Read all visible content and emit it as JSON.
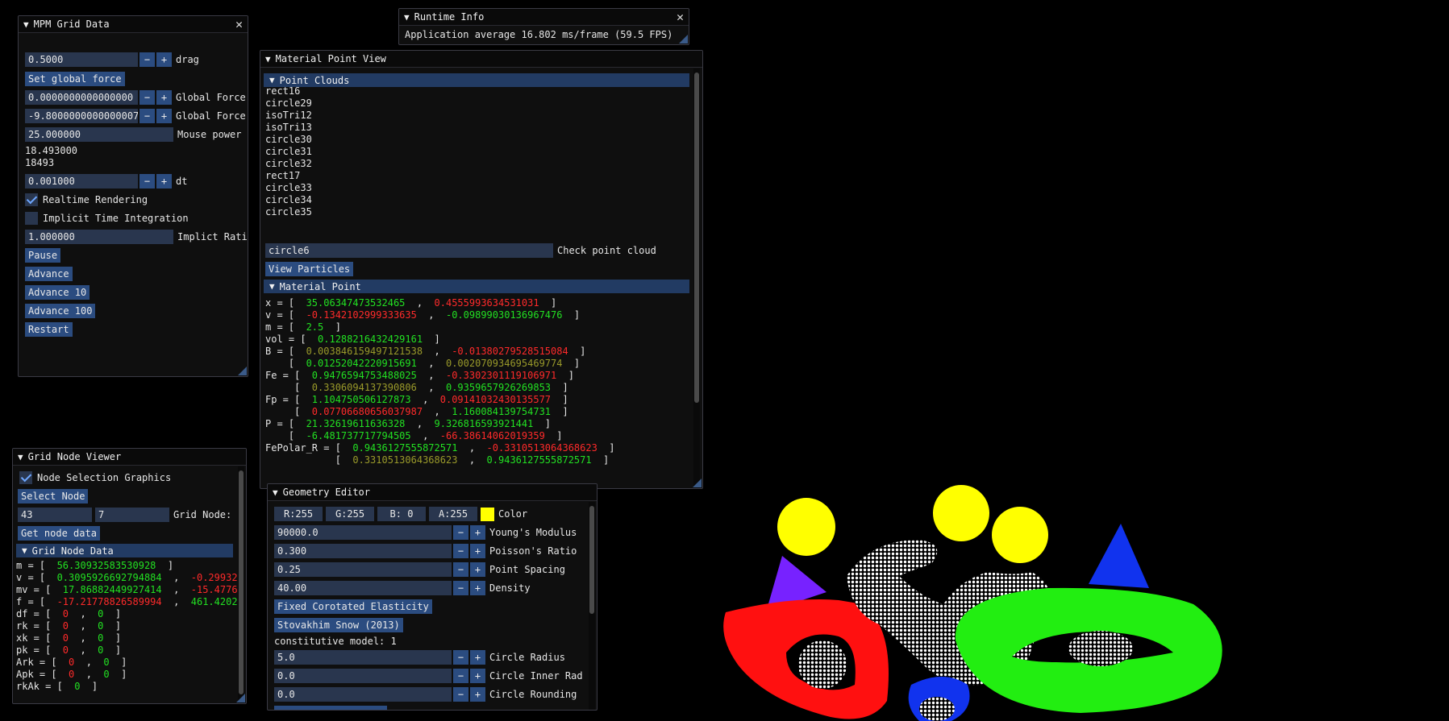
{
  "mpm": {
    "title": "MPM Grid Data",
    "drag": {
      "value": "0.5000",
      "label": "drag"
    },
    "set_force_btn": "Set global force",
    "force_x": {
      "value": "0.0000000000000000",
      "label": "Global Force"
    },
    "force_y": {
      "value": "-9.8000000000000007",
      "label": "Global Force"
    },
    "mouse_power": {
      "value": "25.000000",
      "label": "Mouse power"
    },
    "stat1": "18.493000",
    "stat2": "18493",
    "dt": {
      "value": "0.001000",
      "label": "dt"
    },
    "realtime_label": "Realtime Rendering",
    "implicit_label": "Implicit Time Integration",
    "implicit_ratio": {
      "value": "1.000000",
      "label": "Implict Rati"
    },
    "pause": "Pause",
    "advance": "Advance",
    "advance10": "Advance 10",
    "advance100": "Advance 100",
    "restart": "Restart",
    "minus": "−",
    "plus": "+"
  },
  "runtime": {
    "title": "Runtime Info",
    "text": "Application average 16.802 ms/frame (59.5 FPS)"
  },
  "mpv": {
    "title": "Material Point View",
    "point_clouds_header": "Point Clouds",
    "clouds": [
      "rect16",
      "circle29",
      "isoTri12",
      "isoTri13",
      "circle30",
      "circle31",
      "circle32",
      "rect17",
      "circle33",
      "circle34",
      "circle35"
    ],
    "selected_cloud": "circle6",
    "check_label": "Check point cloud",
    "view_particles": "View Particles",
    "material_point_header": "Material Point",
    "lines": [
      [
        [
          "x = [  ",
          "w"
        ],
        [
          "35.06347473532465",
          "g"
        ],
        [
          "  ,  ",
          "w"
        ],
        [
          "0.4555993634531031",
          "r"
        ],
        [
          "  ]",
          "w"
        ]
      ],
      [
        [
          "v = [  ",
          "w"
        ],
        [
          "-0.1342102999333635",
          "r"
        ],
        [
          "  ,  ",
          "w"
        ],
        [
          "-0.09899030136967476",
          "g"
        ],
        [
          "  ]",
          "w"
        ]
      ],
      [
        [
          "m = [  ",
          "w"
        ],
        [
          "2.5",
          "g"
        ],
        [
          "  ]",
          "w"
        ]
      ],
      [
        [
          "vol = [  ",
          "w"
        ],
        [
          "0.1288216432429161",
          "g"
        ],
        [
          "  ]",
          "w"
        ]
      ],
      [
        [
          "B = [  ",
          "w"
        ],
        [
          "0.003846159497121538",
          "o"
        ],
        [
          "  ,  ",
          "w"
        ],
        [
          "-0.01380279528515084",
          "r"
        ],
        [
          "  ]",
          "w"
        ]
      ],
      [
        [
          "    [  ",
          "w"
        ],
        [
          "0.01252042220915691",
          "g"
        ],
        [
          "  ,  ",
          "w"
        ],
        [
          "0.002070934695469774",
          "o"
        ],
        [
          "  ]",
          "w"
        ]
      ],
      [
        [
          "Fe = [  ",
          "w"
        ],
        [
          "0.9476594753488025",
          "g"
        ],
        [
          "  ,  ",
          "w"
        ],
        [
          "-0.3302301119106971",
          "r"
        ],
        [
          "  ]",
          "w"
        ]
      ],
      [
        [
          "     [  ",
          "w"
        ],
        [
          "0.3306094137390806",
          "o"
        ],
        [
          "  ,  ",
          "w"
        ],
        [
          "0.9359657926269853",
          "g"
        ],
        [
          "  ]",
          "w"
        ]
      ],
      [
        [
          "Fp = [  ",
          "w"
        ],
        [
          "1.104750506127873",
          "g"
        ],
        [
          "  ,  ",
          "w"
        ],
        [
          "0.09141032430135577",
          "r"
        ],
        [
          "  ]",
          "w"
        ]
      ],
      [
        [
          "     [  ",
          "w"
        ],
        [
          "0.07706680656037987",
          "r"
        ],
        [
          "  ,  ",
          "w"
        ],
        [
          "1.160084139754731",
          "g"
        ],
        [
          "  ]",
          "w"
        ]
      ],
      [
        [
          "P = [  ",
          "w"
        ],
        [
          "21.32619611636328",
          "g"
        ],
        [
          "  ,  ",
          "w"
        ],
        [
          "9.326816593921441",
          "g"
        ],
        [
          "  ]",
          "w"
        ]
      ],
      [
        [
          "    [  ",
          "w"
        ],
        [
          "-6.481737717794505",
          "g"
        ],
        [
          "  ,  ",
          "w"
        ],
        [
          "-66.38614062019359",
          "r"
        ],
        [
          "  ]",
          "w"
        ]
      ],
      [
        [
          "FePolar_R = [  ",
          "w"
        ],
        [
          "0.9436127555872571",
          "g"
        ],
        [
          "  ,  ",
          "w"
        ],
        [
          "-0.3310513064368623",
          "r"
        ],
        [
          "  ]",
          "w"
        ]
      ],
      [
        [
          "            [  ",
          "w"
        ],
        [
          "0.3310513064368623",
          "o"
        ],
        [
          "  ,  ",
          "w"
        ],
        [
          "0.9436127555872571",
          "g"
        ],
        [
          "  ]",
          "w"
        ]
      ]
    ]
  },
  "gnv": {
    "title": "Grid Node Viewer",
    "node_graphics_label": "Node Selection Graphics",
    "select_node": "Select Node",
    "node_x": "43",
    "node_y": "7",
    "grid_node_label": "Grid Node:",
    "get_node_data": "Get node data",
    "grid_node_data_header": "Grid Node Data",
    "lines": [
      [
        [
          "m = [  ",
          "w"
        ],
        [
          "56.30932583530928",
          "g"
        ],
        [
          "  ]",
          "w"
        ]
      ],
      [
        [
          "v = [  ",
          "w"
        ],
        [
          "0.3095926692794884",
          "g"
        ],
        [
          "  ,  ",
          "w"
        ],
        [
          "-0.29932",
          "r"
        ]
      ],
      [
        [
          "mv = [  ",
          "w"
        ],
        [
          "17.86882449927414",
          "g"
        ],
        [
          "  ,  ",
          "w"
        ],
        [
          "-15.4776",
          "r"
        ]
      ],
      [
        [
          "f = [  ",
          "w"
        ],
        [
          "-17.21778826589994",
          "r"
        ],
        [
          "  ,  ",
          "w"
        ],
        [
          "461.4202",
          "g"
        ]
      ],
      [
        [
          "df = [  ",
          "w"
        ],
        [
          "0",
          "r"
        ],
        [
          "  ,  ",
          "w"
        ],
        [
          "0",
          "g"
        ],
        [
          "  ]",
          "w"
        ]
      ],
      [
        [
          "rk = [  ",
          "w"
        ],
        [
          "0",
          "r"
        ],
        [
          "  ,  ",
          "w"
        ],
        [
          "0",
          "g"
        ],
        [
          "  ]",
          "w"
        ]
      ],
      [
        [
          "xk = [  ",
          "w"
        ],
        [
          "0",
          "r"
        ],
        [
          "  ,  ",
          "w"
        ],
        [
          "0",
          "g"
        ],
        [
          "  ]",
          "w"
        ]
      ],
      [
        [
          "pk = [  ",
          "w"
        ],
        [
          "0",
          "r"
        ],
        [
          "  ,  ",
          "w"
        ],
        [
          "0",
          "g"
        ],
        [
          "  ]",
          "w"
        ]
      ],
      [
        [
          "Ark = [  ",
          "w"
        ],
        [
          "0",
          "r"
        ],
        [
          "  ,  ",
          "w"
        ],
        [
          "0",
          "g"
        ],
        [
          "  ]",
          "w"
        ]
      ],
      [
        [
          "Apk = [  ",
          "w"
        ],
        [
          "0",
          "r"
        ],
        [
          "  ,  ",
          "w"
        ],
        [
          "0",
          "g"
        ],
        [
          "  ]",
          "w"
        ]
      ],
      [
        [
          "rkAk = [  ",
          "w"
        ],
        [
          "0",
          "g"
        ],
        [
          "  ]",
          "w"
        ]
      ]
    ]
  },
  "geo": {
    "title": "Geometry Editor",
    "r": "R:255",
    "g": "G:255",
    "b": "B:  0",
    "a": "A:255",
    "swatch_color": "#ffff00",
    "color_label": "Color",
    "youngs": {
      "value": "90000.0",
      "label": "Young's Modulus"
    },
    "poisson": {
      "value": "0.300",
      "label": "Poisson's Ratio"
    },
    "spacing": {
      "value": "0.25",
      "label": "Point Spacing"
    },
    "density": {
      "value": "40.00",
      "label": "Density"
    },
    "fixed_corotated": "Fixed Corotated Elasticity",
    "stovakhim": "Stovakhim Snow (2013)",
    "constitutive": "constitutive model: 1",
    "radius": {
      "value": "5.0",
      "label": "Circle Radius"
    },
    "inner": {
      "value": "0.0",
      "label": "Circle Inner Rad"
    },
    "rounding": {
      "value": "0.0",
      "label": "Circle Rounding"
    },
    "minus": "−",
    "plus": "+"
  },
  "sim_colors": {
    "red": "#ff1010",
    "green": "#22ee11",
    "blue": "#1133ee",
    "yellow": "#ffff00",
    "purple": "#7722ff",
    "white": "#ffffff"
  }
}
